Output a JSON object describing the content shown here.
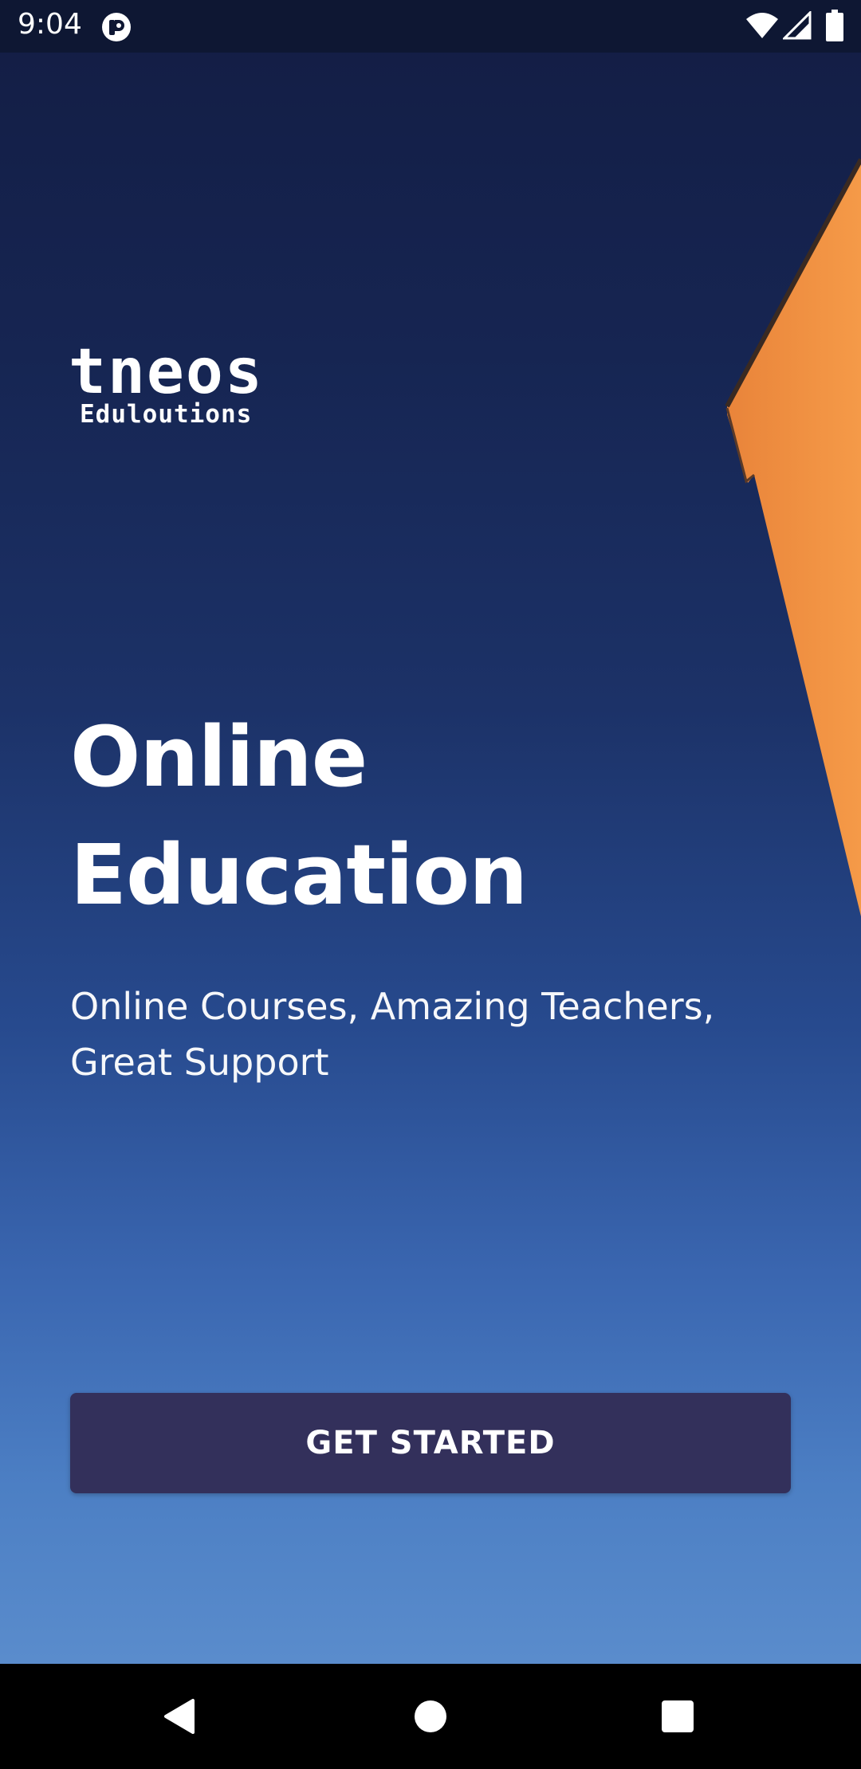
{
  "status_bar": {
    "time": "9:04",
    "app_icon": "notification-app-icon",
    "wifi_icon": "wifi-icon",
    "signal_icon": "cellular-signal-icon",
    "battery_icon": "battery-icon"
  },
  "logo": {
    "main": "tneos",
    "sub": "Eduloutions"
  },
  "hero": {
    "headline_line1": "Online",
    "headline_line2": "Education",
    "subtitle_line1": "Online Courses, Amazing Teachers,",
    "subtitle_line2": "Great Support"
  },
  "cta": {
    "label": "GET STARTED"
  },
  "nav_bar": {
    "back_icon": "back-triangle-icon",
    "home_icon": "home-circle-icon",
    "recent_icon": "recent-apps-square-icon"
  },
  "colors": {
    "sky_top": "#131d44",
    "sky_bottom": "#6a97d0",
    "building": "#f39240",
    "button": "#33305b",
    "status_bar": "#0e1733"
  }
}
